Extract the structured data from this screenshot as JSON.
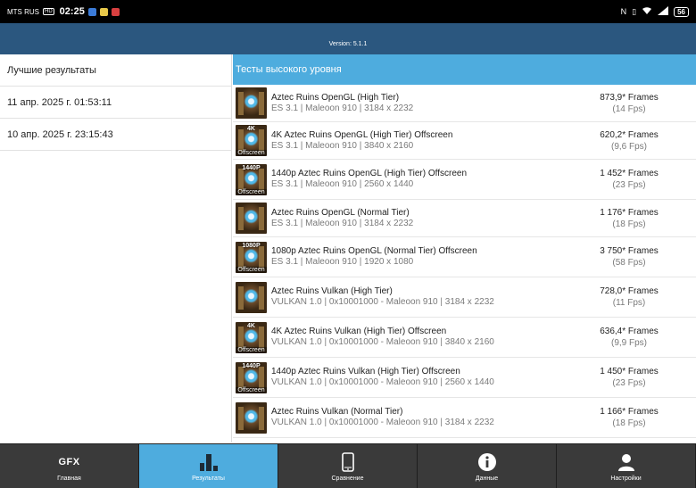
{
  "status_bar": {
    "carrier": "MTS RUS",
    "network_badge": "HD",
    "time": "02:25",
    "battery": "56",
    "icons": [
      "sim-hd-icon",
      "app-icon-blue",
      "app-icon-yellow",
      "app-icon-red",
      "nfc-icon",
      "vibrate-icon",
      "wifi-icon",
      "signal-icon"
    ]
  },
  "header": {
    "version": "Version: 5.1.1"
  },
  "left_panel": {
    "title": "Лучшие результаты",
    "items": [
      "11 апр. 2025 г. 01:53:11",
      "10 апр. 2025 г. 23:15:43"
    ]
  },
  "right_panel": {
    "title": "Тесты высокого уровня",
    "rows": [
      {
        "name": "Aztec Ruins OpenGL (High Tier)",
        "sub": "ES 3.1 | Maleoon 910 | 3184 x 2232",
        "frames": "873,9* Frames",
        "fps": "(14 Fps)",
        "tag_top": "",
        "tag_bottom": ""
      },
      {
        "name": "4K Aztec Ruins OpenGL (High Tier) Offscreen",
        "sub": "ES 3.1 | Maleoon 910 | 3840 x 2160",
        "frames": "620,2* Frames",
        "fps": "(9,6 Fps)",
        "tag_top": "4K",
        "tag_bottom": "Offscreen"
      },
      {
        "name": "1440p Aztec Ruins OpenGL (High Tier) Offscreen",
        "sub": "ES 3.1 | Maleoon 910 | 2560 x 1440",
        "frames": "1 452* Frames",
        "fps": "(23 Fps)",
        "tag_top": "1440P",
        "tag_bottom": "Offscreen"
      },
      {
        "name": "Aztec Ruins OpenGL (Normal Tier)",
        "sub": "ES 3.1 | Maleoon 910 | 3184 x 2232",
        "frames": "1 176* Frames",
        "fps": "(18 Fps)",
        "tag_top": "",
        "tag_bottom": ""
      },
      {
        "name": "1080p Aztec Ruins OpenGL (Normal Tier) Offscreen",
        "sub": "ES 3.1 | Maleoon 910 | 1920 x 1080",
        "frames": "3 750* Frames",
        "fps": "(58 Fps)",
        "tag_top": "1080P",
        "tag_bottom": "Offscreen"
      },
      {
        "name": "Aztec Ruins Vulkan (High Tier)",
        "sub": "VULKAN 1.0 | 0x10001000 - Maleoon 910 | 3184 x 2232",
        "frames": "728,0* Frames",
        "fps": "(11 Fps)",
        "tag_top": "",
        "tag_bottom": ""
      },
      {
        "name": "4K Aztec Ruins Vulkan (High Tier) Offscreen",
        "sub": "VULKAN 1.0 | 0x10001000 - Maleoon 910 | 3840 x 2160",
        "frames": "636,4* Frames",
        "fps": "(9,9 Fps)",
        "tag_top": "4K",
        "tag_bottom": "Offscreen"
      },
      {
        "name": "1440p Aztec Ruins Vulkan (High Tier) Offscreen",
        "sub": "VULKAN 1.0 | 0x10001000 - Maleoon 910 | 2560 x 1440",
        "frames": "1 450* Frames",
        "fps": "(23 Fps)",
        "tag_top": "1440P",
        "tag_bottom": "Offscreen"
      },
      {
        "name": "Aztec Ruins Vulkan (Normal Tier)",
        "sub": "VULKAN 1.0 | 0x10001000 - Maleoon 910 | 3184 x 2232",
        "frames": "1 166* Frames",
        "fps": "(18 Fps)",
        "tag_top": "",
        "tag_bottom": ""
      }
    ]
  },
  "bottom_nav": {
    "items": [
      {
        "label": "Главная",
        "icon": "gfx-logo-icon",
        "icon_text": "GFX",
        "active": false
      },
      {
        "label": "Результаты",
        "icon": "bar-chart-icon",
        "icon_text": "",
        "active": true
      },
      {
        "label": "Сравнение",
        "icon": "phone-icon",
        "icon_text": "",
        "active": false
      },
      {
        "label": "Данные",
        "icon": "info-icon",
        "icon_text": "",
        "active": false
      },
      {
        "label": "Настройки",
        "icon": "user-icon",
        "icon_text": "",
        "active": false
      }
    ]
  },
  "colors": {
    "header": "#2b577f",
    "accent": "#4eacde",
    "nav_bg": "#3a3a3a"
  }
}
